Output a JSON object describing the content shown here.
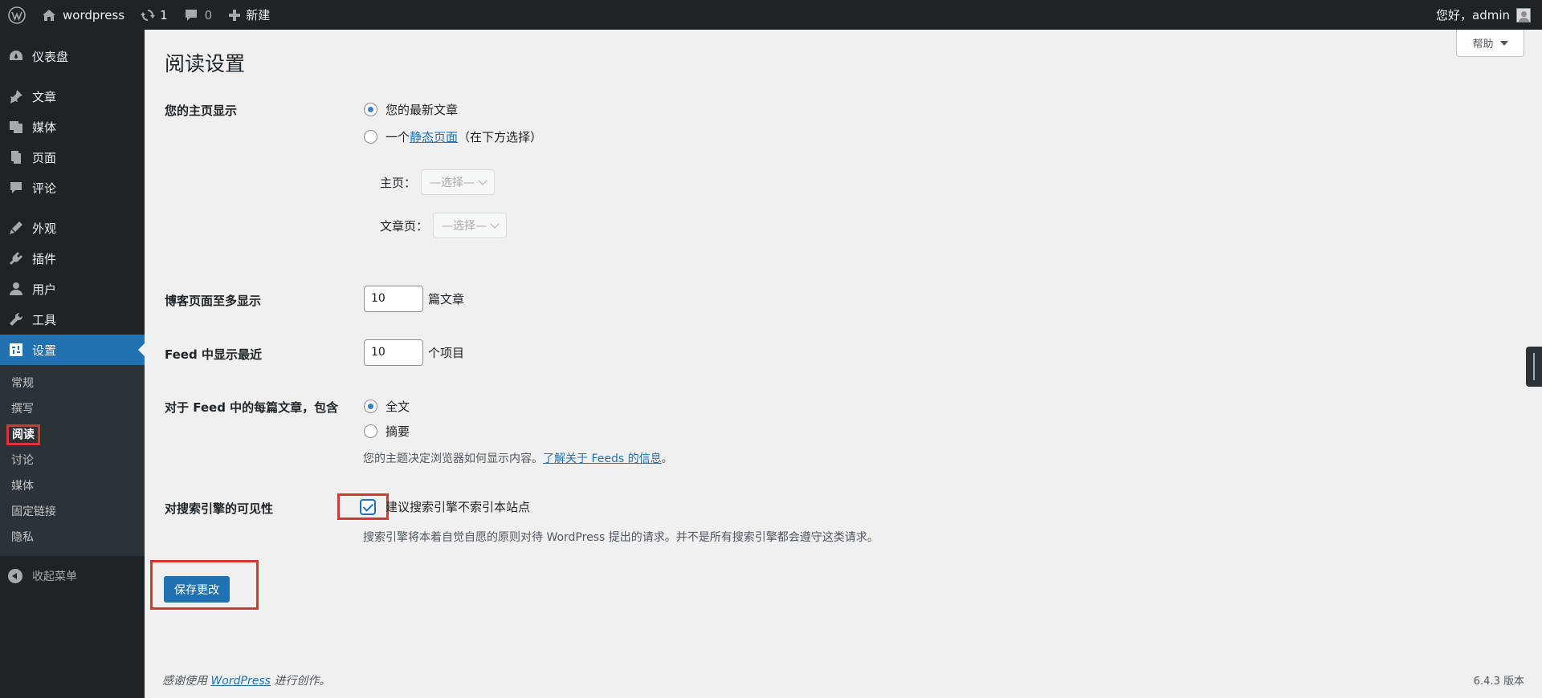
{
  "adminbar": {
    "site_name": "wordpress",
    "updates_count": "1",
    "comments_count": "0",
    "new_label": "新建",
    "greeting": "您好，admin"
  },
  "sidebar": {
    "items": [
      {
        "label": "仪表盘",
        "icon": "dashboard-icon"
      },
      {
        "label": "文章",
        "icon": "pin-icon"
      },
      {
        "label": "媒体",
        "icon": "media-icon"
      },
      {
        "label": "页面",
        "icon": "page-icon"
      },
      {
        "label": "评论",
        "icon": "comment-icon"
      },
      {
        "label": "外观",
        "icon": "appearance-icon"
      },
      {
        "label": "插件",
        "icon": "plugin-icon"
      },
      {
        "label": "用户",
        "icon": "user-icon"
      },
      {
        "label": "工具",
        "icon": "wrench-icon"
      },
      {
        "label": "设置",
        "icon": "settings-icon"
      }
    ],
    "submenu": [
      "常规",
      "撰写",
      "阅读",
      "讨论",
      "媒体",
      "固定链接",
      "隐私"
    ],
    "collapse_label": "收起菜单"
  },
  "content": {
    "help_label": "帮助",
    "title": "阅读设置",
    "homepage": {
      "label": "您的主页显示",
      "option1": "您的最新文章",
      "option2_prefix": "一个",
      "option2_link": "静态页面",
      "option2_suffix": "（在下方选择）",
      "front_label": "主页：",
      "posts_label": "文章页：",
      "select_placeholder": "—选择—"
    },
    "posts_per_page": {
      "label": "博客页面至多显示",
      "value": "10",
      "unit": "篇文章"
    },
    "feed_count": {
      "label": "Feed 中显示最近",
      "value": "10",
      "unit": "个项目"
    },
    "feed_content": {
      "label": "对于 Feed 中的每篇文章，包含",
      "option1": "全文",
      "option2": "摘要",
      "desc_prefix": "您的主题决定浏览器如何显示内容。",
      "desc_link": "了解关于 Feeds 的信息",
      "desc_suffix": "。"
    },
    "search_visibility": {
      "label": "对搜索引擎的可见性",
      "checkbox_label": "建议搜索引擎不索引本站点",
      "desc": "搜索引擎将本着自觉自愿的原则对待 WordPress 提出的请求。并不是所有搜索引擎都会遵守这类请求。"
    },
    "save_label": "保存更改"
  },
  "footer": {
    "left_prefix": "感谢使用",
    "left_link": "WordPress",
    "left_suffix": "进行创作。",
    "version": "6.4.3 版本"
  }
}
